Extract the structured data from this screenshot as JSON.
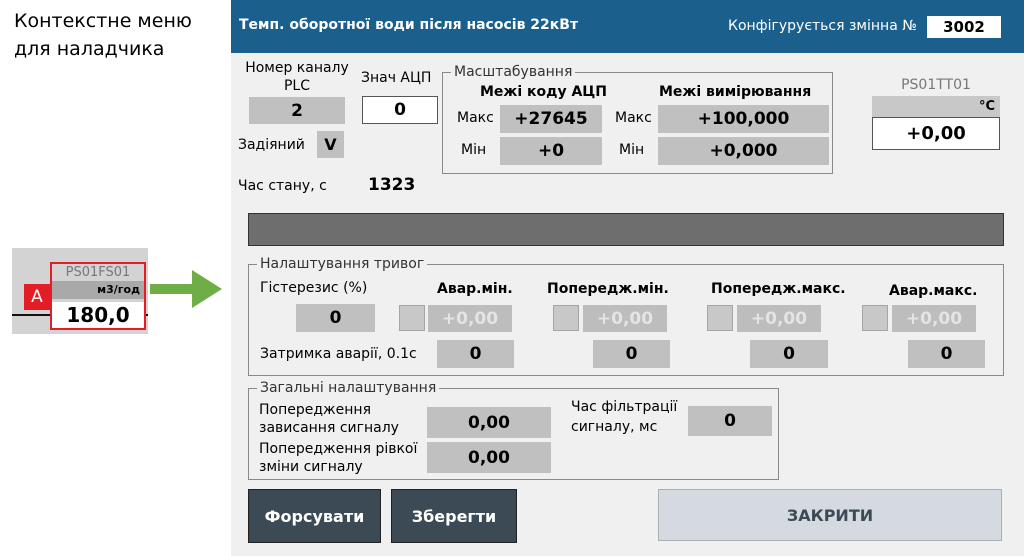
{
  "note": {
    "line1": "Контекстне меню",
    "line2": "для наладчика"
  },
  "widget": {
    "tag": "PS01FS01",
    "unit": "м3/год",
    "value": "180,0",
    "alarm_letter": "A"
  },
  "dialog": {
    "title": "Темп. оборотної води після насосів 22кВт",
    "config_label": "Конфігурується змінна №",
    "config_value": "3002",
    "channel": {
      "label_line1": "Номер каналу",
      "label_line2": "PLC",
      "value": "2"
    },
    "adc": {
      "label": "Знач АЦП",
      "value": "0"
    },
    "enabled": {
      "label": "Задіяний",
      "value": "V"
    },
    "state_time": {
      "label": "Час стану, с",
      "value": "1323"
    },
    "scaling": {
      "legend": "Масштабування",
      "code_limits": "Межі коду АЦП",
      "measure_limits": "Межі вимірювання",
      "max_label": "Макс",
      "min_label": "Мін",
      "code_max": "+27645",
      "code_min": "+0",
      "meas_max": "+100,000",
      "meas_min": "+0,000"
    },
    "sensor": {
      "tag": "PS01TT01",
      "unit": "°C",
      "value": "+0,00"
    },
    "alarms": {
      "legend": "Налаштування тривог",
      "hysteresis_label": "Гістерезис (%)",
      "hysteresis_value": "0",
      "delay_label": "Затримка аварії, 0.1с",
      "columns": [
        {
          "label": "Авар.мін.",
          "value": "+0,00",
          "delay": "0"
        },
        {
          "label": "Попередж.мін.",
          "value": "+0,00",
          "delay": "0"
        },
        {
          "label": "Попередж.макс.",
          "value": "+0,00",
          "delay": "0"
        },
        {
          "label": "Авар.макс.",
          "value": "+0,00",
          "delay": "0"
        }
      ]
    },
    "general": {
      "legend": "Загальні налаштування",
      "hang_label_1": "Попередження",
      "hang_label_2": "зависання сигналу",
      "hang_value": "0,00",
      "jump_label_1": "Попередження рівкої",
      "jump_label_2": "зміни сигналу",
      "jump_value": "0,00",
      "filter_label_1": "Час фільтрації",
      "filter_label_2": "сигналу, мс",
      "filter_value": "0"
    },
    "buttons": {
      "force": "Форсувати",
      "save": "Зберегти",
      "close": "ЗАКРИТИ"
    }
  },
  "colors": {
    "title_bar": "#1b5f8c",
    "dark_button": "#3b4a55",
    "arrow": "#6fad46",
    "alarm": "#e21d26"
  }
}
